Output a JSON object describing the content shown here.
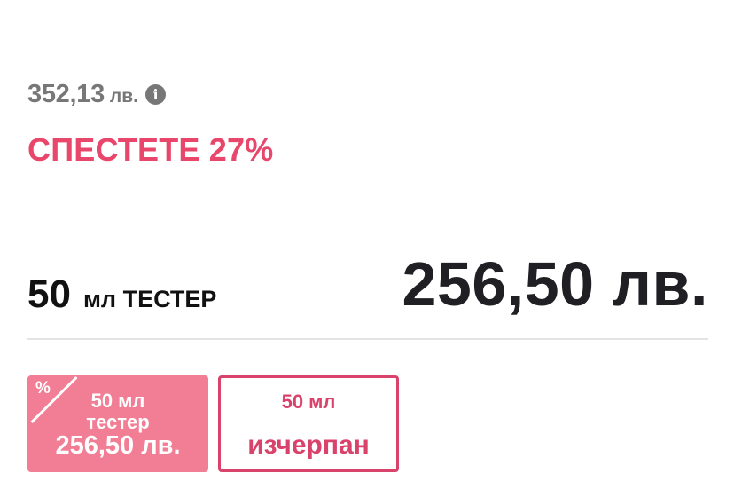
{
  "pricing": {
    "old_price_amount": "352,13",
    "old_price_currency": "лв.",
    "info_icon": "info-circle-icon",
    "savings_text": "СПЕСТЕТЕ 27%",
    "current_variant_size": "50",
    "current_variant_rest": "мл ТЕСТЕР",
    "current_price": "256,50 лв."
  },
  "options": [
    {
      "size": "50 мл",
      "type": "тестер",
      "price": "256,50 лв.",
      "discount_mark": "%",
      "selected": true
    },
    {
      "size": "50 мл",
      "status": "изчерпан",
      "selected": false
    }
  ],
  "colors": {
    "accent": "#e8466a",
    "selected_option_bg": "#f17e94",
    "muted_text": "#777777",
    "price_text": "#1f1f24"
  }
}
